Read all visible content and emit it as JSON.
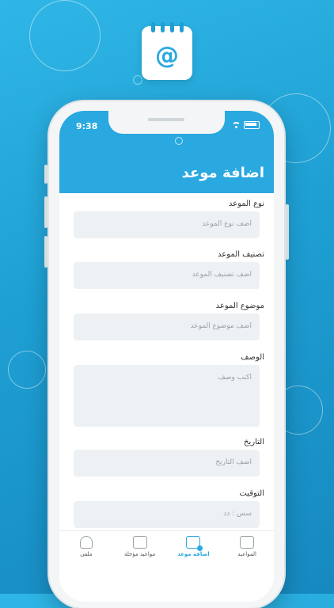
{
  "status_bar": {
    "time": "9:38"
  },
  "header": {
    "title": "اضافة موعد"
  },
  "form": {
    "fields": [
      {
        "label": "نوع الموعد",
        "placeholder": "اضف نوع الموعد"
      },
      {
        "label": "تصنيف الموعد",
        "placeholder": "اضف تصنيف الموعد"
      },
      {
        "label": "موضوع الموعد",
        "placeholder": "اضف موضوع الموعد"
      },
      {
        "label": "الوصف",
        "placeholder": "اكتب وصف"
      },
      {
        "label": "التاريخ",
        "placeholder": "اضف التاريخ"
      },
      {
        "label": "التوقيت",
        "placeholder": "سس : دد"
      }
    ]
  },
  "tabbar": {
    "items": [
      {
        "label": "المواعيد",
        "icon": "calendar-grid-icon"
      },
      {
        "label": "اضافة موعد",
        "icon": "calendar-add-icon",
        "active": true
      },
      {
        "label": "مواعيد مؤجلة",
        "icon": "calendar-clock-icon"
      },
      {
        "label": "ملفى",
        "icon": "person-icon"
      }
    ]
  },
  "colors": {
    "accent": "#2aa8e0",
    "background": "#1e9fd3"
  }
}
